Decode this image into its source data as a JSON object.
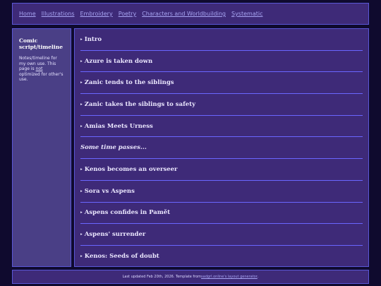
{
  "nav": {
    "links": [
      "Home",
      "Illustrations",
      "Embroidery",
      "Poetry",
      "Characters and Worldbuilding",
      "Systematic"
    ]
  },
  "sidebar": {
    "title": "Comic script/timeline",
    "text_before": "Notes/timeline for my own use. This page is ",
    "text_emph": "not",
    "text_after": " optimized for other's use."
  },
  "main": {
    "items": [
      {
        "label": "Intro",
        "arrow": "▸"
      },
      {
        "label": "Azure is taken down",
        "arrow": "▸"
      },
      {
        "label": "Zanic tends to the siblings",
        "arrow": "▸"
      },
      {
        "label": "Zanic takes the siblings to safety",
        "arrow": "▸"
      },
      {
        "label": "Amias Meets Urness",
        "arrow": "▸"
      },
      {
        "label": "Some time passes...",
        "arrow": ""
      },
      {
        "label": "Kenos becomes an overseer",
        "arrow": "▸"
      },
      {
        "label": "Sora vs Aspens",
        "arrow": "▸"
      },
      {
        "label": "Aspens confides in Pamět",
        "arrow": "▸"
      },
      {
        "label": "Aspens' surrender",
        "arrow": "▸"
      },
      {
        "label": "Kenos: Seeds of doubt",
        "arrow": "▸"
      }
    ]
  },
  "footer": {
    "text": "Last updated Feb 20th, 2026. Template from ",
    "link": "sadgrl.online's layout generator",
    "end": "."
  }
}
